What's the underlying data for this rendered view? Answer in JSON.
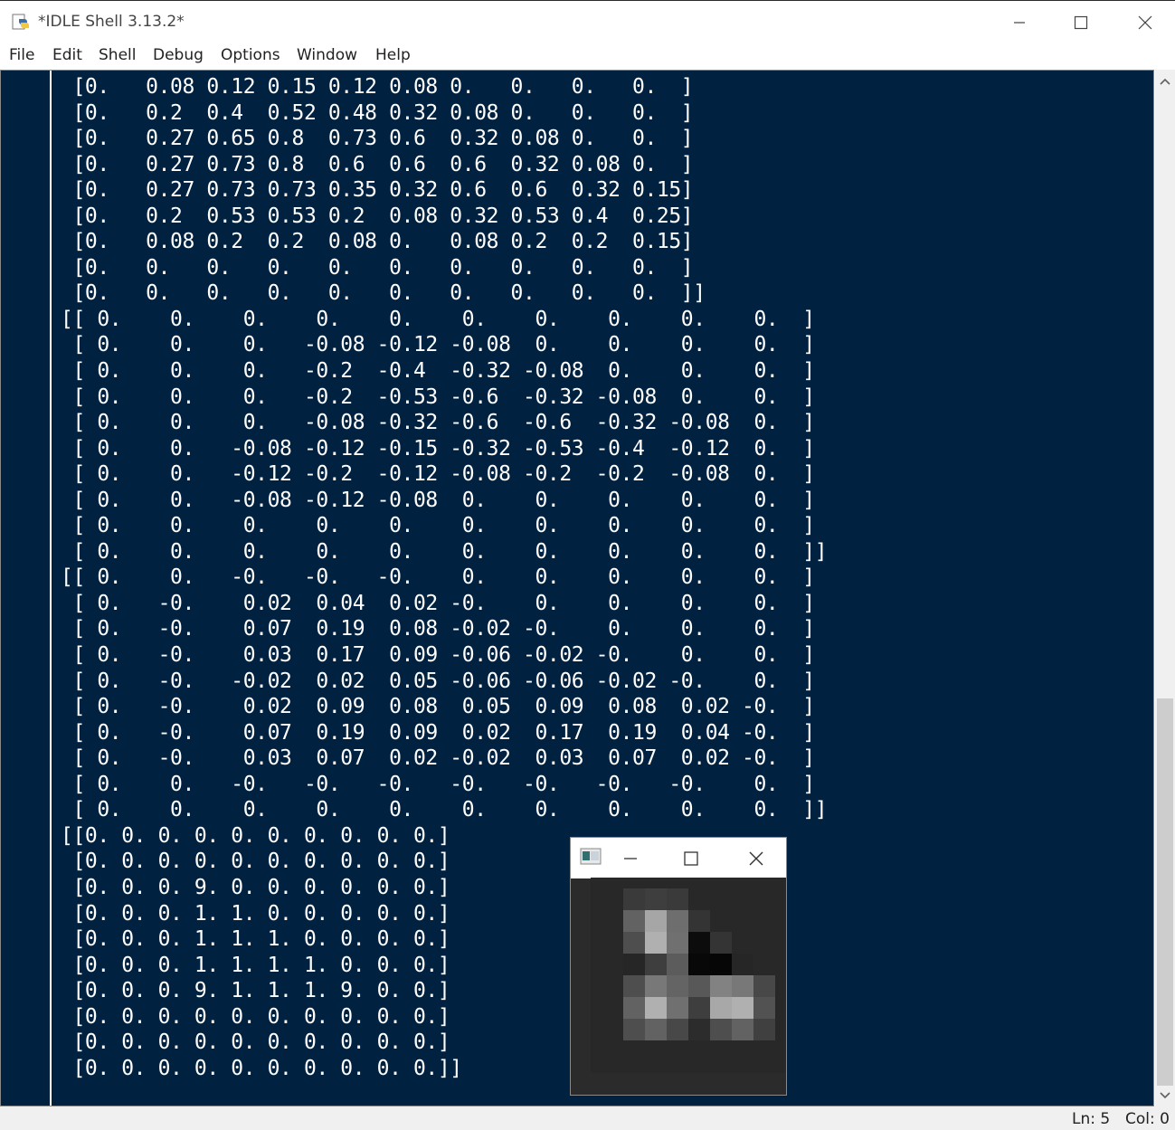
{
  "window": {
    "title": "*IDLE Shell 3.13.2*",
    "controls": [
      "minimize",
      "maximize",
      "close"
    ]
  },
  "menu": {
    "items": [
      "File",
      "Edit",
      "Shell",
      "Debug",
      "Options",
      "Window",
      "Help"
    ]
  },
  "shell": {
    "background": "#002240",
    "foreground": "#ffffff",
    "output": " [0.   0.08 0.12 0.15 0.12 0.08 0.   0.   0.   0.  ]\n [0.   0.2  0.4  0.52 0.48 0.32 0.08 0.   0.   0.  ]\n [0.   0.27 0.65 0.8  0.73 0.6  0.32 0.08 0.   0.  ]\n [0.   0.27 0.73 0.8  0.6  0.6  0.6  0.32 0.08 0.  ]\n [0.   0.27 0.73 0.73 0.35 0.32 0.6  0.6  0.32 0.15]\n [0.   0.2  0.53 0.53 0.2  0.08 0.32 0.53 0.4  0.25]\n [0.   0.08 0.2  0.2  0.08 0.   0.08 0.2  0.2  0.15]\n [0.   0.   0.   0.   0.   0.   0.   0.   0.   0.  ]\n [0.   0.   0.   0.   0.   0.   0.   0.   0.   0.  ]]\n[[ 0.    0.    0.    0.    0.    0.    0.    0.    0.    0.  ]\n [ 0.    0.    0.   -0.08 -0.12 -0.08  0.    0.    0.    0.  ]\n [ 0.    0.    0.   -0.2  -0.4  -0.32 -0.08  0.    0.    0.  ]\n [ 0.    0.    0.   -0.2  -0.53 -0.6  -0.32 -0.08  0.    0.  ]\n [ 0.    0.    0.   -0.08 -0.32 -0.6  -0.6  -0.32 -0.08  0.  ]\n [ 0.    0.   -0.08 -0.12 -0.15 -0.32 -0.53 -0.4  -0.12  0.  ]\n [ 0.    0.   -0.12 -0.2  -0.12 -0.08 -0.2  -0.2  -0.08  0.  ]\n [ 0.    0.   -0.08 -0.12 -0.08  0.    0.    0.    0.    0.  ]\n [ 0.    0.    0.    0.    0.    0.    0.    0.    0.    0.  ]\n [ 0.    0.    0.    0.    0.    0.    0.    0.    0.    0.  ]]\n[[ 0.    0.   -0.   -0.   -0.    0.    0.    0.    0.    0.  ]\n [ 0.   -0.    0.02  0.04  0.02 -0.    0.    0.    0.    0.  ]\n [ 0.   -0.    0.07  0.19  0.08 -0.02 -0.    0.    0.    0.  ]\n [ 0.   -0.    0.03  0.17  0.09 -0.06 -0.02 -0.    0.    0.  ]\n [ 0.   -0.   -0.02  0.02  0.05 -0.06 -0.06 -0.02 -0.    0.  ]\n [ 0.   -0.    0.02  0.09  0.08  0.05  0.09  0.08  0.02 -0.  ]\n [ 0.   -0.    0.07  0.19  0.09  0.02  0.17  0.19  0.04 -0.  ]\n [ 0.   -0.    0.03  0.07  0.02 -0.02  0.03  0.07  0.02 -0.  ]\n [ 0.    0.   -0.   -0.   -0.   -0.   -0.   -0.   -0.    0.  ]\n [ 0.    0.    0.    0.    0.    0.    0.    0.    0.    0.  ]]\n[[0. 0. 0. 0. 0. 0. 0. 0. 0. 0.]\n [0. 0. 0. 0. 0. 0. 0. 0. 0. 0.]\n [0. 0. 0. 9. 0. 0. 0. 0. 0. 0.]\n [0. 0. 0. 1. 1. 0. 0. 0. 0. 0.]\n [0. 0. 0. 1. 1. 1. 0. 0. 0. 0.]\n [0. 0. 0. 1. 1. 1. 1. 0. 0. 0.]\n [0. 0. 0. 9. 1. 1. 1. 9. 0. 0.]\n [0. 0. 0. 0. 0. 0. 0. 0. 0. 0.]\n [0. 0. 0. 0. 0. 0. 0. 0. 0. 0.]\n [0. 0. 0. 0. 0. 0. 0. 0. 0. 0.]]"
  },
  "status": {
    "ln": "Ln: 5",
    "col": "Col: 0"
  },
  "image_window": {
    "icons": [
      "image-app-icon",
      "minimize-icon",
      "maximize-icon",
      "close-icon"
    ],
    "pixels_note": "grayscale 10x10 levels (0-255)",
    "pixels": [
      [
        40,
        40,
        40,
        40,
        40,
        40,
        40,
        40,
        40,
        40
      ],
      [
        40,
        40,
        58,
        62,
        58,
        40,
        40,
        40,
        40,
        40
      ],
      [
        40,
        40,
        98,
        166,
        110,
        52,
        40,
        40,
        40,
        40
      ],
      [
        40,
        40,
        78,
        176,
        112,
        12,
        52,
        40,
        40,
        40
      ],
      [
        40,
        40,
        38,
        62,
        92,
        8,
        6,
        38,
        40,
        40
      ],
      [
        40,
        40,
        78,
        120,
        100,
        88,
        130,
        120,
        72,
        40
      ],
      [
        40,
        40,
        98,
        176,
        112,
        62,
        168,
        176,
        82,
        40
      ],
      [
        40,
        40,
        78,
        98,
        72,
        44,
        78,
        98,
        64,
        40
      ],
      [
        40,
        40,
        40,
        40,
        40,
        40,
        40,
        40,
        40,
        40
      ],
      [
        40,
        40,
        40,
        40,
        40,
        40,
        40,
        40,
        40,
        40
      ]
    ]
  }
}
